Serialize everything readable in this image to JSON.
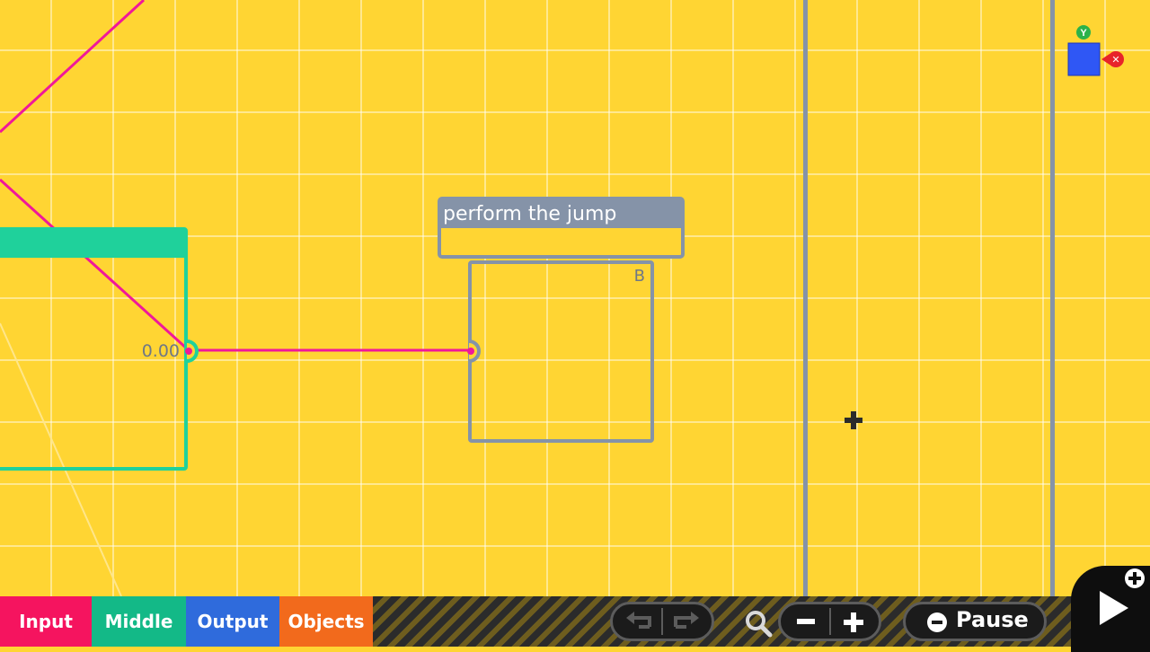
{
  "canvas": {
    "middle_node": {
      "port_value": "0.00"
    },
    "comment": {
      "title": "perform the jump"
    },
    "output_node": {
      "key_label": "B"
    },
    "axis_widget": {
      "y_label": "Y",
      "x_label": "✕"
    }
  },
  "toolbar": {
    "tabs": [
      {
        "label": "Input",
        "color": "#f5145f"
      },
      {
        "label": "Middle",
        "color": "#13b987"
      },
      {
        "label": "Output",
        "color": "#2f6bdc"
      },
      {
        "label": "Objects",
        "color": "#f26a1c"
      }
    ],
    "pause_label": "Pause"
  },
  "colors": {
    "background": "#FFD533",
    "wire": "#f0189a",
    "node_border": "#8593a8",
    "middle_node": "#1fd19b"
  },
  "icons": [
    "undo-icon",
    "redo-icon",
    "magnify-icon",
    "zoom-out-icon",
    "zoom-in-icon",
    "minus-button-icon",
    "play-icon",
    "plus-badge-icon",
    "crosshair-cursor-icon"
  ]
}
